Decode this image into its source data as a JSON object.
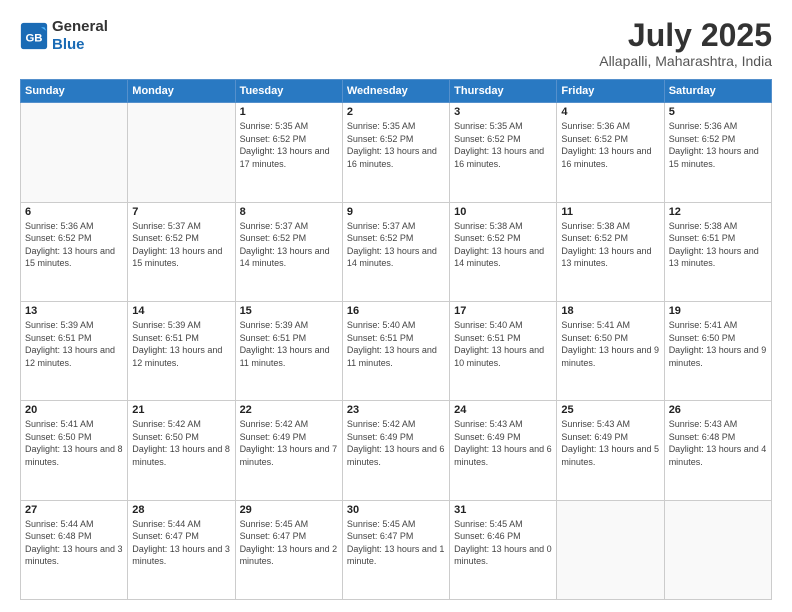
{
  "header": {
    "logo_line1": "General",
    "logo_line2": "Blue",
    "month": "July 2025",
    "location": "Allapalli, Maharashtra, India"
  },
  "weekdays": [
    "Sunday",
    "Monday",
    "Tuesday",
    "Wednesday",
    "Thursday",
    "Friday",
    "Saturday"
  ],
  "weeks": [
    [
      null,
      null,
      {
        "day": 1,
        "sunrise": "5:35 AM",
        "sunset": "6:52 PM",
        "daylight": "13 hours and 17 minutes."
      },
      {
        "day": 2,
        "sunrise": "5:35 AM",
        "sunset": "6:52 PM",
        "daylight": "13 hours and 16 minutes."
      },
      {
        "day": 3,
        "sunrise": "5:35 AM",
        "sunset": "6:52 PM",
        "daylight": "13 hours and 16 minutes."
      },
      {
        "day": 4,
        "sunrise": "5:36 AM",
        "sunset": "6:52 PM",
        "daylight": "13 hours and 16 minutes."
      },
      {
        "day": 5,
        "sunrise": "5:36 AM",
        "sunset": "6:52 PM",
        "daylight": "13 hours and 15 minutes."
      }
    ],
    [
      {
        "day": 6,
        "sunrise": "5:36 AM",
        "sunset": "6:52 PM",
        "daylight": "13 hours and 15 minutes."
      },
      {
        "day": 7,
        "sunrise": "5:37 AM",
        "sunset": "6:52 PM",
        "daylight": "13 hours and 15 minutes."
      },
      {
        "day": 8,
        "sunrise": "5:37 AM",
        "sunset": "6:52 PM",
        "daylight": "13 hours and 14 minutes."
      },
      {
        "day": 9,
        "sunrise": "5:37 AM",
        "sunset": "6:52 PM",
        "daylight": "13 hours and 14 minutes."
      },
      {
        "day": 10,
        "sunrise": "5:38 AM",
        "sunset": "6:52 PM",
        "daylight": "13 hours and 14 minutes."
      },
      {
        "day": 11,
        "sunrise": "5:38 AM",
        "sunset": "6:52 PM",
        "daylight": "13 hours and 13 minutes."
      },
      {
        "day": 12,
        "sunrise": "5:38 AM",
        "sunset": "6:51 PM",
        "daylight": "13 hours and 13 minutes."
      }
    ],
    [
      {
        "day": 13,
        "sunrise": "5:39 AM",
        "sunset": "6:51 PM",
        "daylight": "13 hours and 12 minutes."
      },
      {
        "day": 14,
        "sunrise": "5:39 AM",
        "sunset": "6:51 PM",
        "daylight": "13 hours and 12 minutes."
      },
      {
        "day": 15,
        "sunrise": "5:39 AM",
        "sunset": "6:51 PM",
        "daylight": "13 hours and 11 minutes."
      },
      {
        "day": 16,
        "sunrise": "5:40 AM",
        "sunset": "6:51 PM",
        "daylight": "13 hours and 11 minutes."
      },
      {
        "day": 17,
        "sunrise": "5:40 AM",
        "sunset": "6:51 PM",
        "daylight": "13 hours and 10 minutes."
      },
      {
        "day": 18,
        "sunrise": "5:41 AM",
        "sunset": "6:50 PM",
        "daylight": "13 hours and 9 minutes."
      },
      {
        "day": 19,
        "sunrise": "5:41 AM",
        "sunset": "6:50 PM",
        "daylight": "13 hours and 9 minutes."
      }
    ],
    [
      {
        "day": 20,
        "sunrise": "5:41 AM",
        "sunset": "6:50 PM",
        "daylight": "13 hours and 8 minutes."
      },
      {
        "day": 21,
        "sunrise": "5:42 AM",
        "sunset": "6:50 PM",
        "daylight": "13 hours and 8 minutes."
      },
      {
        "day": 22,
        "sunrise": "5:42 AM",
        "sunset": "6:49 PM",
        "daylight": "13 hours and 7 minutes."
      },
      {
        "day": 23,
        "sunrise": "5:42 AM",
        "sunset": "6:49 PM",
        "daylight": "13 hours and 6 minutes."
      },
      {
        "day": 24,
        "sunrise": "5:43 AM",
        "sunset": "6:49 PM",
        "daylight": "13 hours and 6 minutes."
      },
      {
        "day": 25,
        "sunrise": "5:43 AM",
        "sunset": "6:49 PM",
        "daylight": "13 hours and 5 minutes."
      },
      {
        "day": 26,
        "sunrise": "5:43 AM",
        "sunset": "6:48 PM",
        "daylight": "13 hours and 4 minutes."
      }
    ],
    [
      {
        "day": 27,
        "sunrise": "5:44 AM",
        "sunset": "6:48 PM",
        "daylight": "13 hours and 3 minutes."
      },
      {
        "day": 28,
        "sunrise": "5:44 AM",
        "sunset": "6:47 PM",
        "daylight": "13 hours and 3 minutes."
      },
      {
        "day": 29,
        "sunrise": "5:45 AM",
        "sunset": "6:47 PM",
        "daylight": "13 hours and 2 minutes."
      },
      {
        "day": 30,
        "sunrise": "5:45 AM",
        "sunset": "6:47 PM",
        "daylight": "13 hours and 1 minute."
      },
      {
        "day": 31,
        "sunrise": "5:45 AM",
        "sunset": "6:46 PM",
        "daylight": "13 hours and 0 minutes."
      },
      null,
      null
    ]
  ]
}
